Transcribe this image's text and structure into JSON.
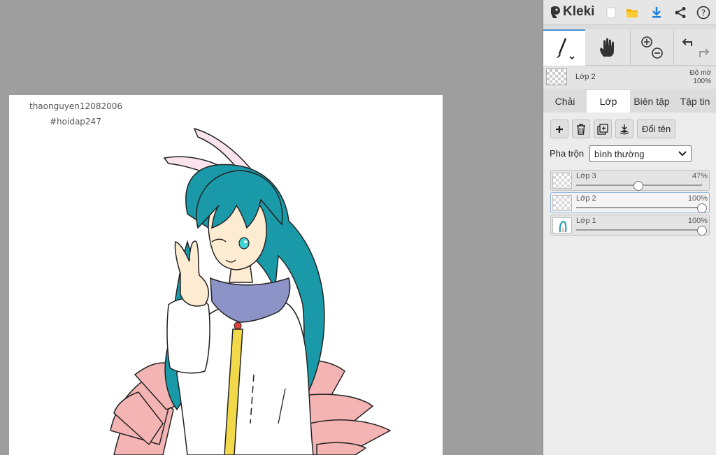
{
  "app": {
    "logo_text": "Kleki",
    "toolbar_icons": [
      "new-file-icon",
      "open-folder-icon",
      "download-icon",
      "share-icon",
      "help-icon"
    ]
  },
  "canvas": {
    "signature_line1": "thaonguyen12082006",
    "signature_line2": "#hoidap247"
  },
  "layer_info": {
    "name": "Lớp 2",
    "opacity_label": "Độ mờ",
    "opacity_value": "100%"
  },
  "tabs": [
    "Chải",
    "Lớp",
    "Biên tập",
    "Tập tin"
  ],
  "active_tab": "Lớp",
  "layer_actions": {
    "rename_label": "Đổi tên"
  },
  "blend": {
    "label": "Pha trộn",
    "value": "bình thường"
  },
  "layers": [
    {
      "name": "Lớp 3",
      "opacity": "47%",
      "opacity_value": 0.47,
      "selected": false
    },
    {
      "name": "Lớp 2",
      "opacity": "100%",
      "opacity_value": 1.0,
      "selected": true
    },
    {
      "name": "Lớp 1",
      "opacity": "100%",
      "opacity_value": 1.0,
      "selected": false
    }
  ],
  "colors": {
    "accent": "#4a8ed0",
    "panel_bg": "#dcdcdc",
    "stage_bg": "#9e9e9e"
  }
}
